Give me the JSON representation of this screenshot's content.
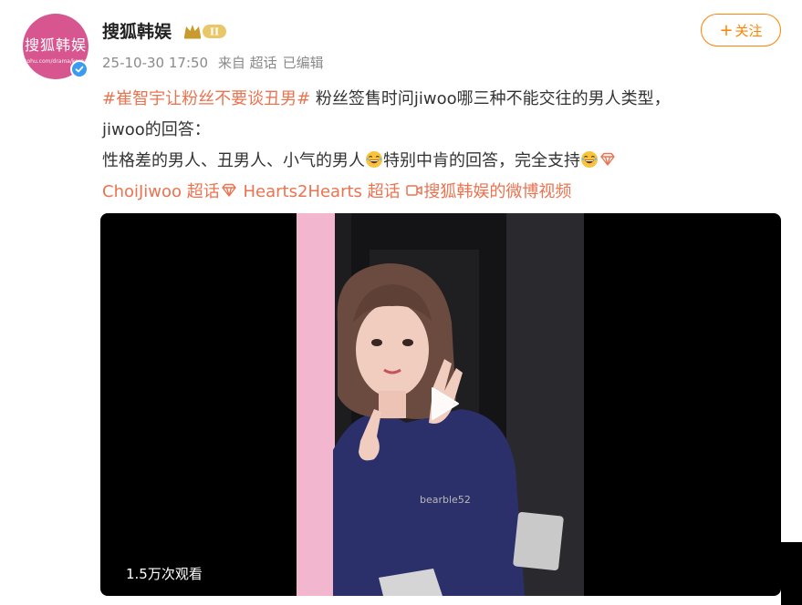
{
  "profile": {
    "avatar_text": "搜狐韩娱",
    "avatar_url_text": "sohu.com/drama/korea",
    "username": "搜狐韩娱",
    "vip_badge": "II",
    "timestamp": "25-10-30 17:50",
    "source": "来自 超话",
    "edited": "已编辑"
  },
  "follow_button": {
    "label": "关注"
  },
  "post": {
    "hashtag": "#崔智宇让粉丝不要谈丑男#",
    "line1_text": " 粉丝签售时问jiwoo哪三种不能交往的男人类型，",
    "line2_text": "jiwoo的回答：",
    "line3_text_a": "性格差的男人、丑男人、小气的男人",
    "line3_text_b": "特别中肯的回答，完全支持",
    "supertopic1": "ChoiJiwoo 超话",
    "supertopic2": "Hearts2Hearts 超话",
    "video_link": "搜狐韩娱的微博视频"
  },
  "video": {
    "view_count": "1.5万次观看",
    "watermark": "bearble52"
  },
  "icons": {
    "verified": "verified-check-icon",
    "crown": "crown-icon",
    "plus": "plus-icon",
    "emoji_laugh": "laughing-emoji-icon",
    "diamond": "diamond-icon",
    "video": "video-link-icon",
    "play": "play-icon"
  },
  "colors": {
    "accent": "#ff8200",
    "link": "#eb7350",
    "avatar_bg": "#d8568f",
    "verified": "#3a9bf0"
  }
}
